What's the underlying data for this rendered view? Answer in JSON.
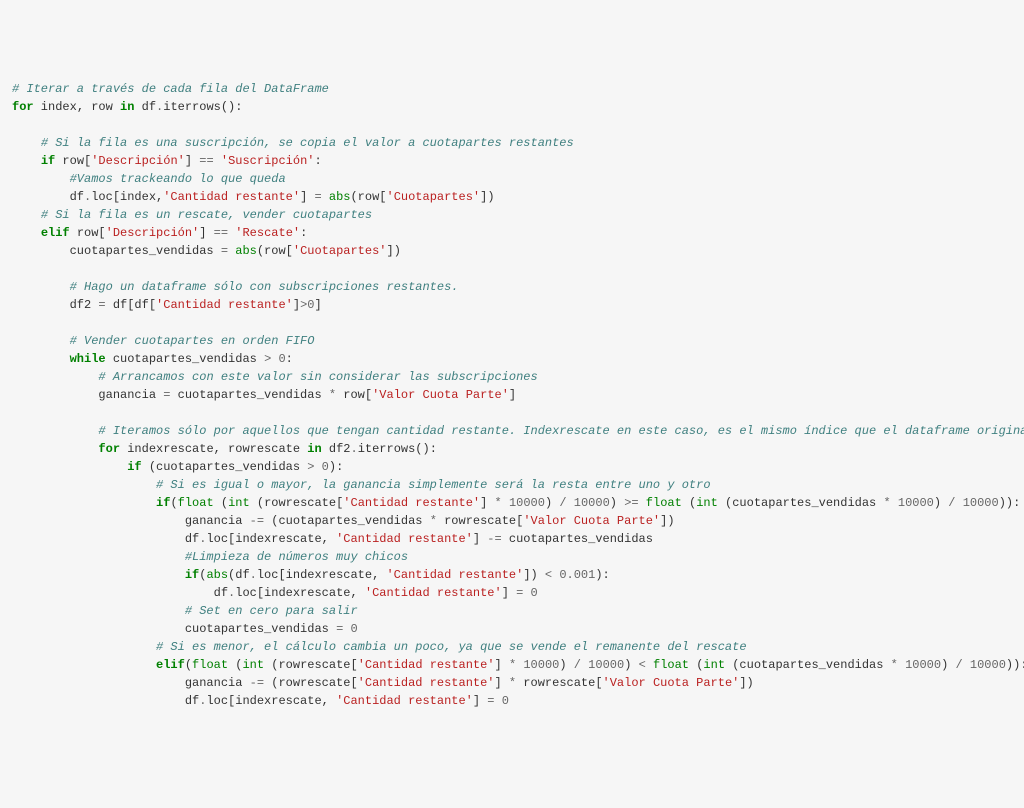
{
  "code": {
    "l1_cm": "# Iterar a través de cada fila del DataFrame",
    "l2_for": "for",
    "l2_in": "in",
    "l2_tx1": " index, row ",
    "l2_tx2": " df",
    "l2_op1": ".",
    "l2_tx3": "iterrows():",
    "l4_cm": "# Si la fila es una suscripción, se copia el valor a cuotapartes restantes",
    "l5_if": "if",
    "l5_tx1": " row[",
    "l5_s1": "'Descripción'",
    "l5_tx2": "] ",
    "l5_op": "==",
    "l5_sp": " ",
    "l5_s2": "'Suscripción'",
    "l5_tx3": ":",
    "l6_cm": "#Vamos trackeando lo que queda",
    "l7_tx1": "df",
    "l7_op1": ".",
    "l7_tx2": "loc[index,",
    "l7_s1": "'Cantidad restante'",
    "l7_tx3": "] ",
    "l7_op2": "=",
    "l7_sp": " ",
    "l7_nb": "abs",
    "l7_tx4": "(row[",
    "l7_s2": "'Cuotapartes'",
    "l7_tx5": "])",
    "l8_cm": "# Si la fila es un rescate, vender cuotapartes",
    "l9_elif": "elif",
    "l9_tx1": " row[",
    "l9_s1": "'Descripción'",
    "l9_tx2": "] ",
    "l9_op": "==",
    "l9_sp": " ",
    "l9_s2": "'Rescate'",
    "l9_tx3": ":",
    "l10_tx1": "cuotapartes_vendidas ",
    "l10_op": "=",
    "l10_sp": " ",
    "l10_nb": "abs",
    "l10_tx2": "(row[",
    "l10_s1": "'Cuotapartes'",
    "l10_tx3": "])",
    "l12_cm": "# Hago un dataframe sólo con subscripciones restantes.",
    "l13_tx1": "df2 ",
    "l13_op1": "=",
    "l13_tx2": " df[df[",
    "l13_s1": "'Cantidad restante'",
    "l13_tx3": "]",
    "l13_op2": ">",
    "l13_n1": "0",
    "l13_tx4": "]",
    "l15_cm": "# Vender cuotapartes en orden FIFO",
    "l16_wh": "while",
    "l16_tx1": " cuotapartes_vendidas ",
    "l16_op": ">",
    "l16_sp": " ",
    "l16_n": "0",
    "l16_tx2": ":",
    "l17_cm": "# Arrancamos con este valor sin considerar las subscripciones",
    "l18_tx1": "ganancia ",
    "l18_op1": "=",
    "l18_tx2": " cuotapartes_vendidas ",
    "l18_op2": "*",
    "l18_tx3": " row[",
    "l18_s1": "'Valor Cuota Parte'",
    "l18_tx4": "]",
    "l20_cm": "# Iteramos sólo por aquellos que tengan cantidad restante. Indexrescate en este caso, es el mismo índice que el dataframe original.",
    "l21_for": "for",
    "l21_tx1": " indexrescate, rowrescate ",
    "l21_in": "in",
    "l21_tx2": " df2",
    "l21_op": ".",
    "l21_tx3": "iterrows():",
    "l22_if": "if",
    "l22_tx1": " (cuotapartes_vendidas ",
    "l22_op": ">",
    "l22_sp": " ",
    "l22_n": "0",
    "l22_tx2": "):",
    "l23_cm": "# Si es igual o mayor, la ganancia simplemente será la resta entre uno y otro",
    "l24_if": "if",
    "l24_tx1": "(",
    "l24_nb1": "float",
    "l24_tx2": " (",
    "l24_nb2": "int",
    "l24_tx3": " (rowrescate[",
    "l24_s1": "'Cantidad restante'",
    "l24_tx4": "] ",
    "l24_op1": "*",
    "l24_sp1": " ",
    "l24_n1": "10000",
    "l24_tx5": ") ",
    "l24_op2": "/",
    "l24_sp2": " ",
    "l24_n2": "10000",
    "l24_tx6": ") ",
    "l24_op3": ">=",
    "l24_sp3": " ",
    "l24_nb3": "float",
    "l24_tx7": " (",
    "l24_nb4": "int",
    "l24_tx8": " (cuotapartes_vendidas ",
    "l24_op4": "*",
    "l24_sp4": " ",
    "l24_n3": "10000",
    "l24_tx9": ") ",
    "l24_op5": "/",
    "l24_sp5": " ",
    "l24_n4": "10000",
    "l24_tx10": ")):",
    "l25_tx1": "ganancia ",
    "l25_op1": "-=",
    "l25_tx2": " (cuotapartes_vendidas ",
    "l25_op2": "*",
    "l25_tx3": " rowrescate[",
    "l25_s1": "'Valor Cuota Parte'",
    "l25_tx4": "])",
    "l26_tx1": "df",
    "l26_op1": ".",
    "l26_tx2": "loc[indexrescate, ",
    "l26_s1": "'Cantidad restante'",
    "l26_tx3": "] ",
    "l26_op2": "-=",
    "l26_tx4": " cuotapartes_vendidas",
    "l27_cm": "#Limpieza de números muy chicos",
    "l28_if": "if",
    "l28_tx1": "(",
    "l28_nb": "abs",
    "l28_tx2": "(df",
    "l28_op1": ".",
    "l28_tx3": "loc[indexrescate, ",
    "l28_s1": "'Cantidad restante'",
    "l28_tx4": "]) ",
    "l28_op2": "<",
    "l28_sp": " ",
    "l28_n": "0.001",
    "l28_tx5": "):",
    "l29_tx1": "df",
    "l29_op1": ".",
    "l29_tx2": "loc[indexrescate, ",
    "l29_s1": "'Cantidad restante'",
    "l29_tx3": "] ",
    "l29_op2": "=",
    "l29_sp": " ",
    "l29_n": "0",
    "l30_cm": "# Set en cero para salir",
    "l31_tx1": "cuotapartes_vendidas ",
    "l31_op": "=",
    "l31_sp": " ",
    "l31_n": "0",
    "l32_cm": "# Si es menor, el cálculo cambia un poco, ya que se vende el remanente del rescate",
    "l33_elif": "elif",
    "l33_tx1": "(",
    "l33_nb1": "float",
    "l33_tx2": " (",
    "l33_nb2": "int",
    "l33_tx3": " (rowrescate[",
    "l33_s1": "'Cantidad restante'",
    "l33_tx4": "] ",
    "l33_op1": "*",
    "l33_sp1": " ",
    "l33_n1": "10000",
    "l33_tx5": ") ",
    "l33_op2": "/",
    "l33_sp2": " ",
    "l33_n2": "10000",
    "l33_tx6": ") ",
    "l33_op3": "<",
    "l33_sp3": " ",
    "l33_nb3": "float",
    "l33_tx7": " (",
    "l33_nb4": "int",
    "l33_tx8": " (cuotapartes_vendidas ",
    "l33_op4": "*",
    "l33_sp4": " ",
    "l33_n3": "10000",
    "l33_tx9": ") ",
    "l33_op5": "/",
    "l33_sp5": " ",
    "l33_n4": "10000",
    "l33_tx10": ")):",
    "l34_tx1": "ganancia ",
    "l34_op1": "-=",
    "l34_tx2": " (rowrescate[",
    "l34_s1": "'Cantidad restante'",
    "l34_tx3": "] ",
    "l34_op2": "*",
    "l34_tx4": " rowrescate[",
    "l34_s2": "'Valor Cuota Parte'",
    "l34_tx5": "])",
    "l35_tx1": "df",
    "l35_op1": ".",
    "l35_tx2": "loc[indexrescate, ",
    "l35_s1": "'Cantidad restante'",
    "l35_tx3": "] ",
    "l35_op2": "=",
    "l35_sp": " ",
    "l35_n": "0"
  }
}
